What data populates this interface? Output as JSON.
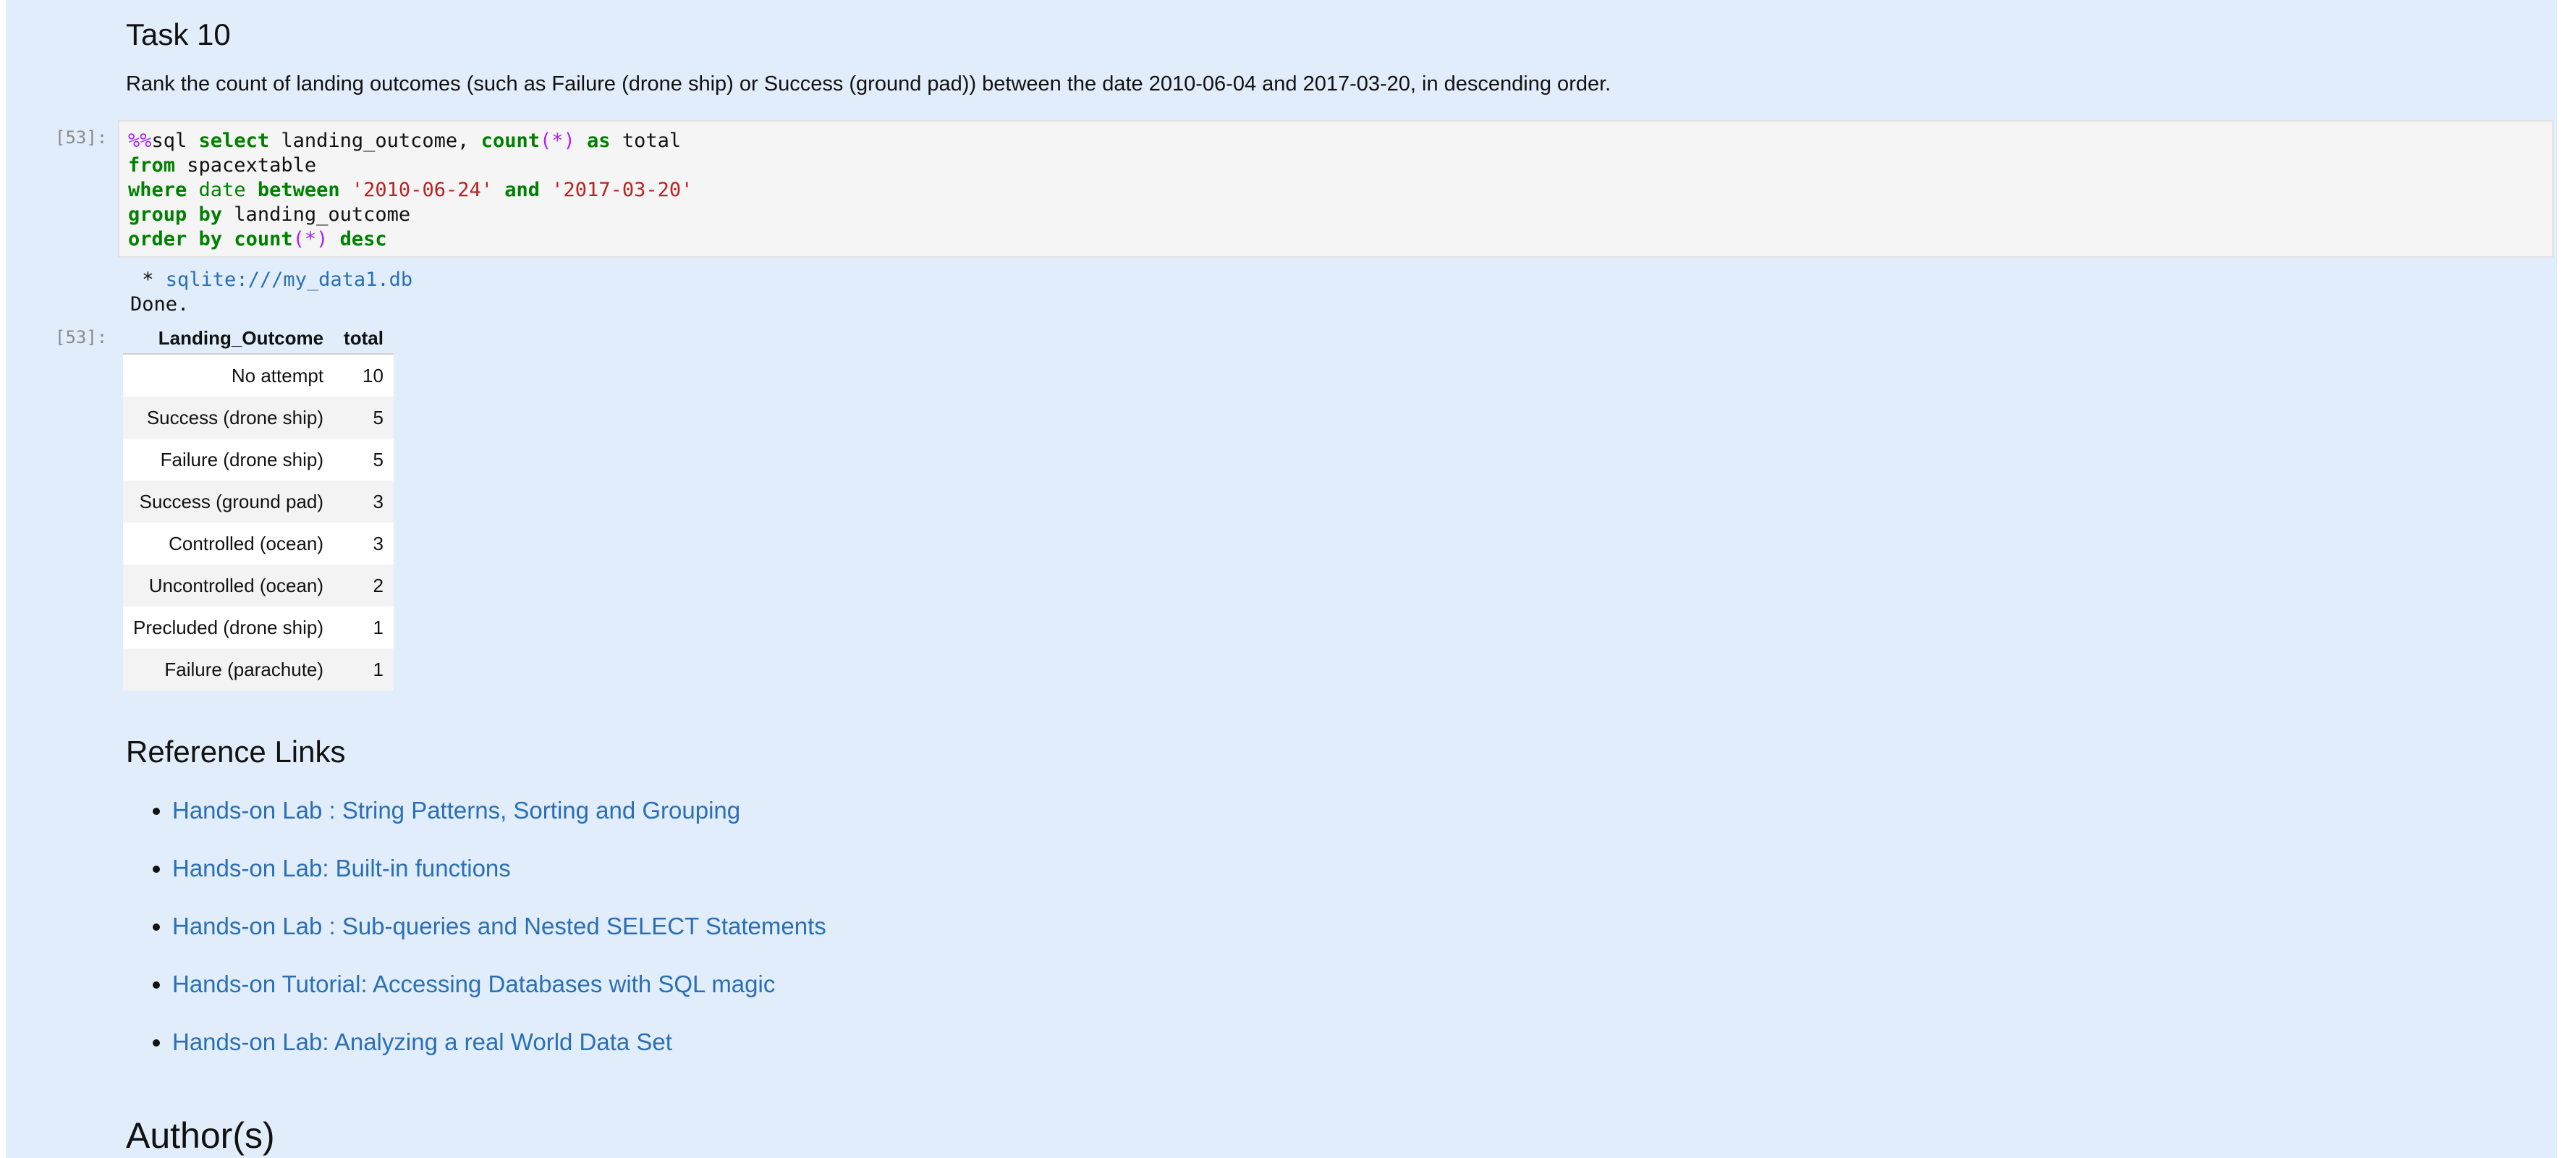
{
  "task": {
    "title": "Task 10",
    "description": "Rank the count of landing outcomes (such as Failure (drone ship) or Success (ground pad)) between the date 2010-06-04 and 2017-03-20, in descending order."
  },
  "cell": {
    "input_prompt": "[53]:",
    "output_prompt": "[53]:",
    "code": {
      "l1": {
        "magic": "%%",
        "sql": "sql ",
        "kw1": "select",
        "rest1": " landing_outcome, ",
        "fn": "count",
        "p1": "(",
        "star": "*",
        "p2": ")",
        "sp": " ",
        "kw2": "as",
        "rest2": " total"
      },
      "l2": {
        "kw": "from",
        "rest": " spacextable"
      },
      "l3": {
        "kw1": "where",
        "sp1": " ",
        "nm": "date",
        "sp2": " ",
        "kw2": "between",
        "sp3": " ",
        "s1": "'2010-06-24'",
        "sp4": " ",
        "kw3": "and",
        "sp5": " ",
        "s2": "'2017-03-20'"
      },
      "l4": {
        "kw": "group by",
        "rest": " landing_outcome"
      },
      "l5": {
        "kw1": "order by",
        "sp1": " ",
        "fn": "count",
        "p1": "(",
        "star": "*",
        "p2": ")",
        "sp2": " ",
        "kw2": "desc"
      }
    },
    "stdout": {
      "bullet": " * ",
      "db_link": "sqlite:///my_data1.db",
      "done": "Done."
    },
    "table": {
      "headers": [
        "Landing_Outcome",
        "total"
      ],
      "rows": [
        [
          "No attempt",
          "10"
        ],
        [
          "Success (drone ship)",
          "5"
        ],
        [
          "Failure (drone ship)",
          "5"
        ],
        [
          "Success (ground pad)",
          "3"
        ],
        [
          "Controlled (ocean)",
          "3"
        ],
        [
          "Uncontrolled (ocean)",
          "2"
        ],
        [
          "Precluded (drone ship)",
          "1"
        ],
        [
          "Failure (parachute)",
          "1"
        ]
      ]
    }
  },
  "references": {
    "title": "Reference Links",
    "links": [
      "Hands-on Lab : String Patterns, Sorting and Grouping",
      "Hands-on Lab: Built-in functions",
      "Hands-on Lab : Sub-queries and Nested SELECT Statements",
      "Hands-on Tutorial: Accessing Databases with SQL magic",
      "Hands-on Lab: Analyzing a real World Data Set"
    ]
  },
  "authors": {
    "title": "Author(s)"
  },
  "colors": {
    "cell_background": "#e1edfa",
    "link": "#2a6fb5",
    "keyword": "#008000",
    "string": "#ba2121",
    "magic": "#aa22ff"
  }
}
